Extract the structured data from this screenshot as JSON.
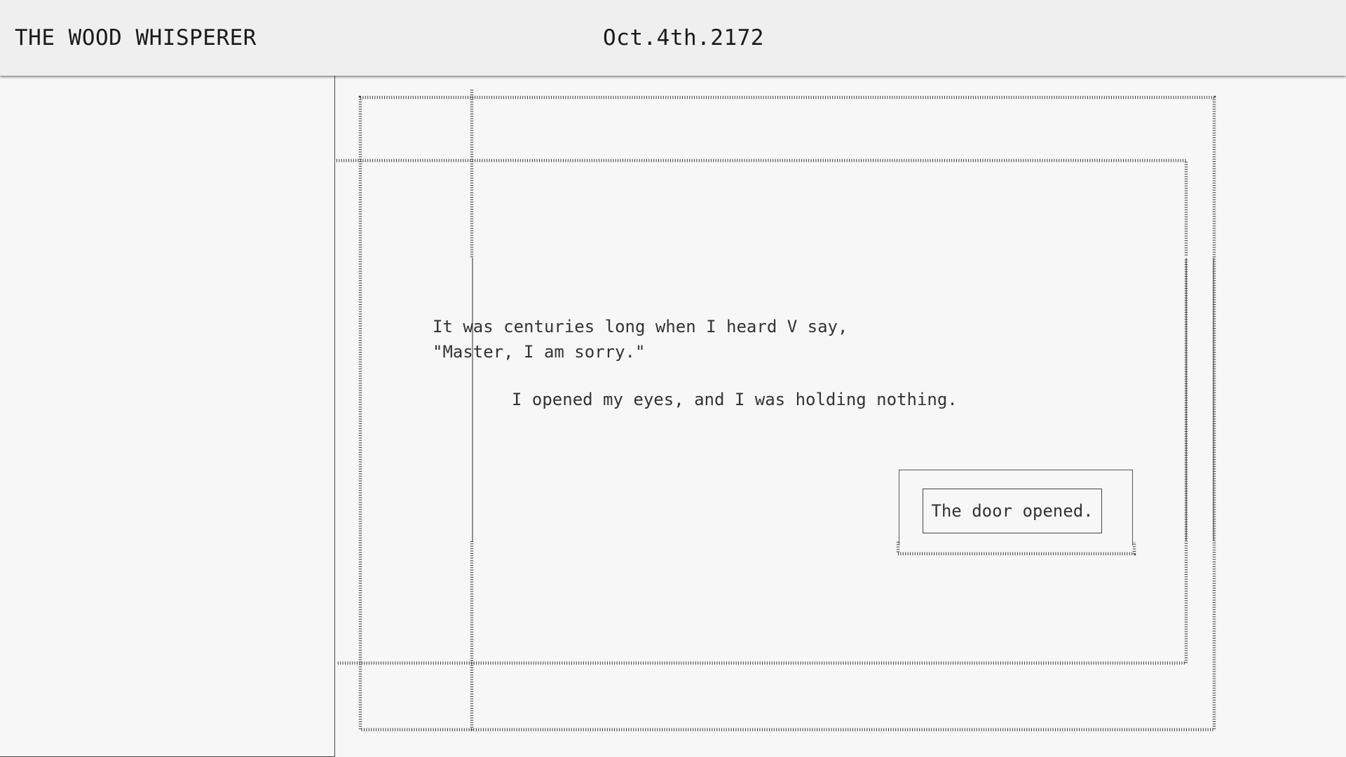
{
  "header": {
    "title": "THE WOOD WHISPERER",
    "date": "Oct.4th.2172"
  },
  "story": {
    "line1": "It was centuries long when I heard V say,",
    "line2": "\"Master, I am sorry.\"",
    "line3": "I opened my eyes, and I was holding nothing."
  },
  "choice": {
    "label": "The door opened."
  }
}
